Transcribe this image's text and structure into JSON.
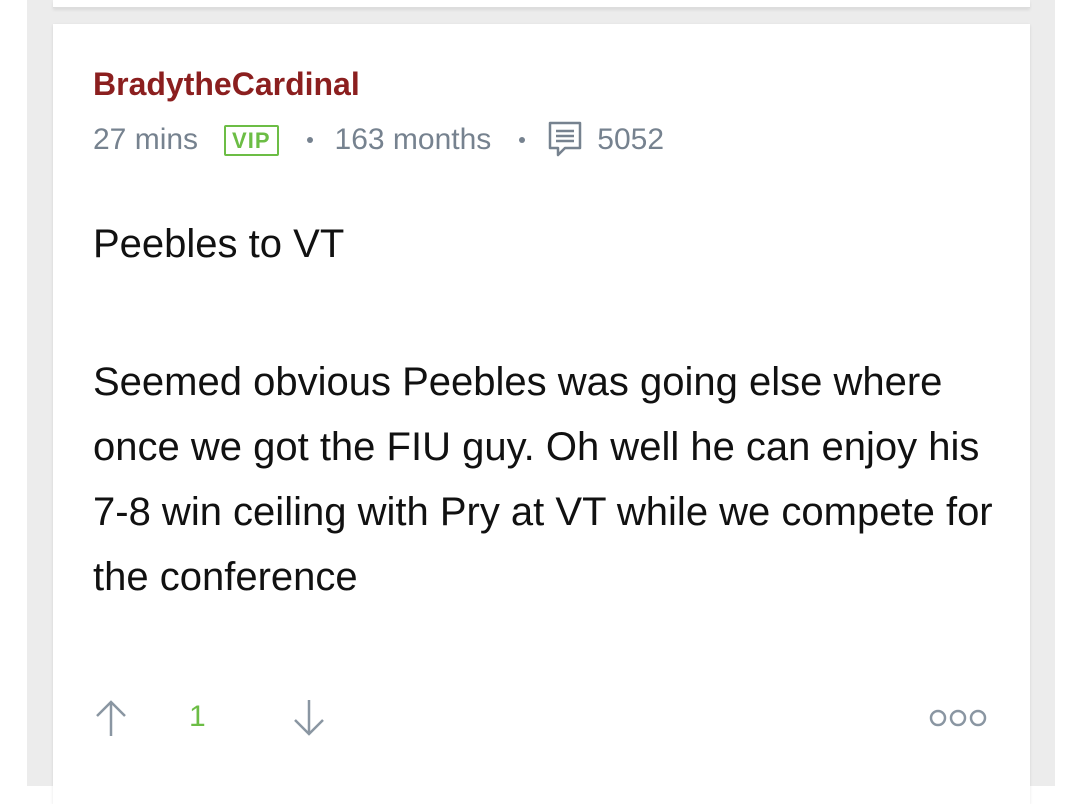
{
  "post": {
    "username": "BradytheCardinal",
    "time_ago": "27 mins",
    "badge": "VIP",
    "membership": "163 months",
    "post_count": "5052",
    "title": "Peebles to VT",
    "body": "Seemed obvious Peebles was going else where once we got the FIU guy. Oh well he can enjoy his 7-8 win ceiling with Pry at VT while we compete for the conference"
  },
  "votes": {
    "score": "1"
  },
  "icons": {
    "comment": "comment-bubble-icon",
    "upvote": "arrow-up-icon",
    "downvote": "arrow-down-icon",
    "more": "more-options-icon"
  },
  "colors": {
    "username": "#8b1f1f",
    "vip": "#6cbd45",
    "meta_text": "#76828f",
    "score": "#6cbd45",
    "body_text": "#111111",
    "page_backdrop": "#ececec"
  }
}
